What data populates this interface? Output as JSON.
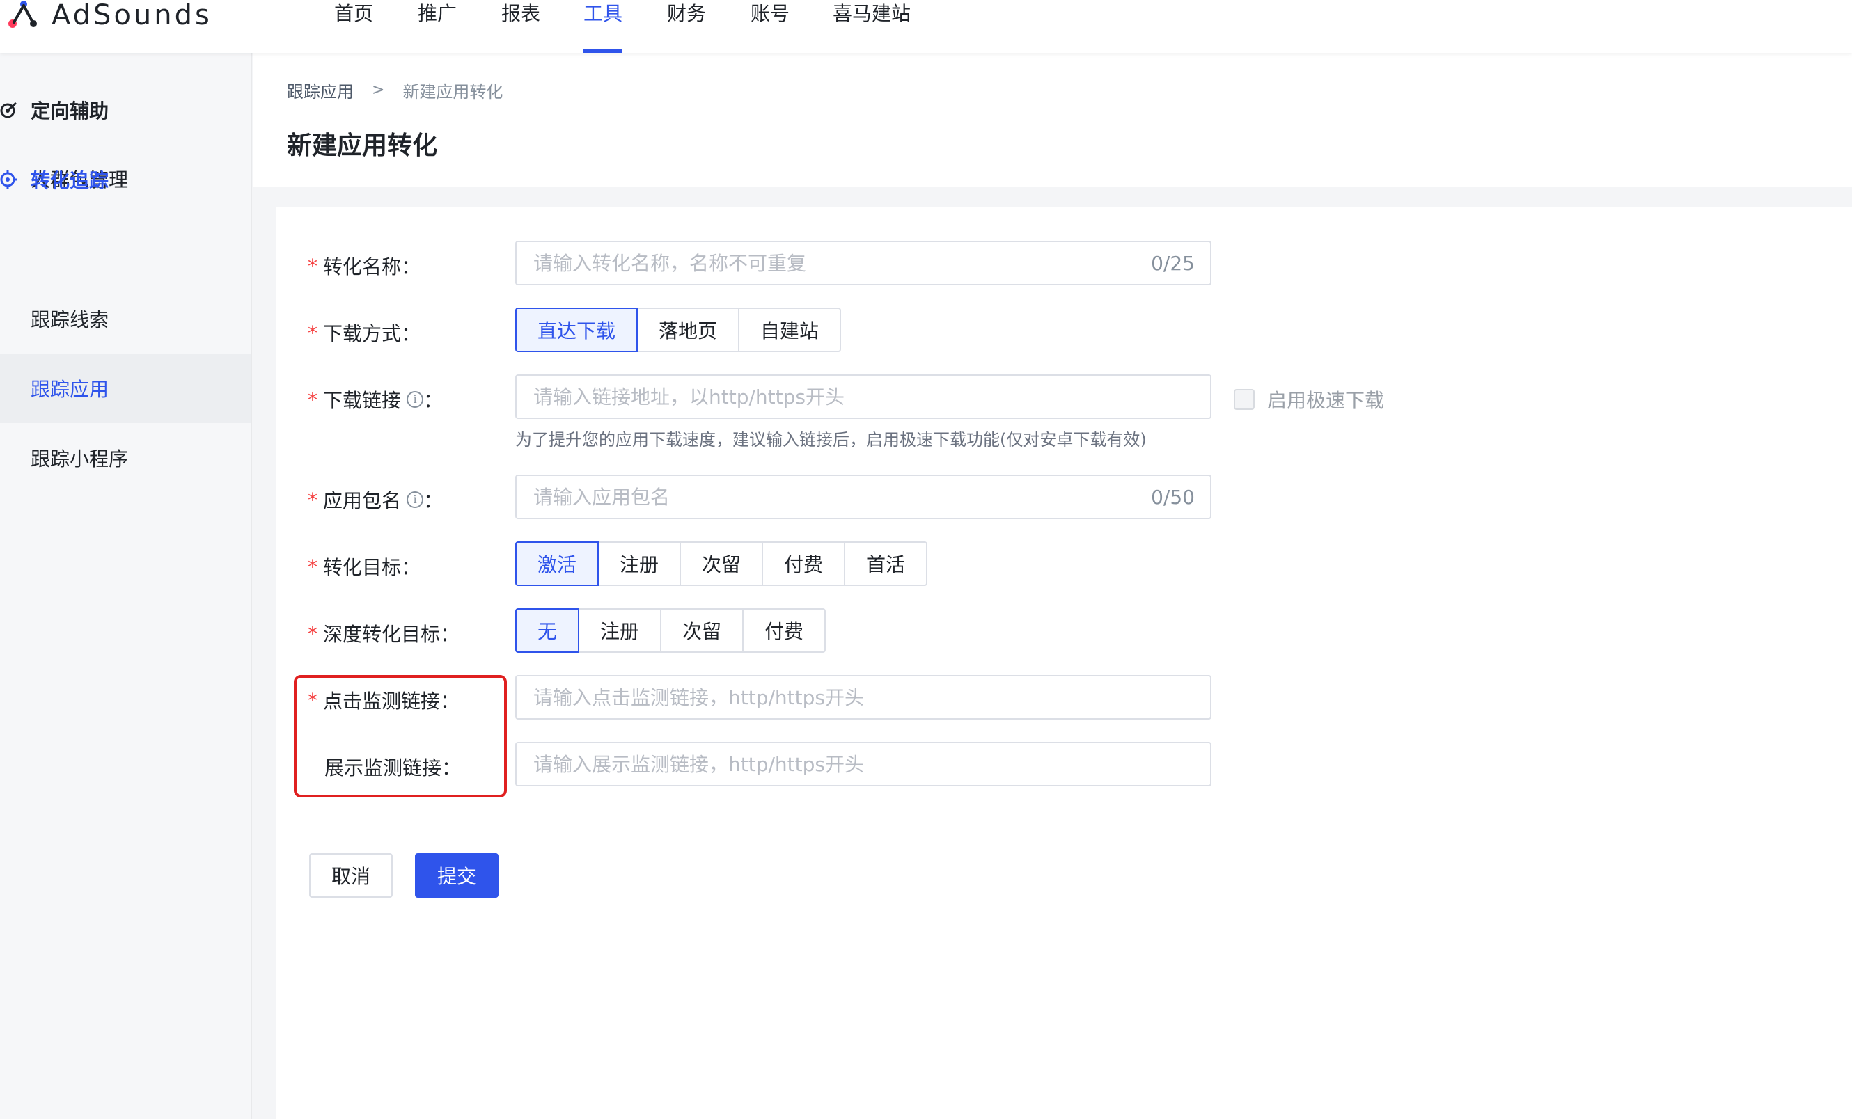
{
  "brand": {
    "name": "AdSounds"
  },
  "nav": {
    "items": [
      "首页",
      "推广",
      "报表",
      "工具",
      "财务",
      "账号",
      "喜马建站"
    ],
    "active_index": 3
  },
  "sidebar": {
    "group1": {
      "label": "定向辅助",
      "icon": "target-icon"
    },
    "item_crowd": "人群包管理",
    "group2": {
      "label": "转化追踪",
      "icon": "crosshair-icon"
    },
    "item_leads": "跟踪线索",
    "item_app": "跟踪应用",
    "item_miniprogram": "跟踪小程序",
    "active_item": "跟踪应用"
  },
  "breadcrumb": {
    "parent": "跟踪应用",
    "separator": ">",
    "current": "新建应用转化"
  },
  "page_title": "新建应用转化",
  "form": {
    "conversion_name": {
      "label": "转化名称",
      "placeholder": "请输入转化名称，名称不可重复",
      "count": "0/25",
      "required": true
    },
    "download_method": {
      "label": "下载方式",
      "options": [
        "直达下载",
        "落地页",
        "自建站"
      ],
      "selected": "直达下载",
      "required": true
    },
    "download_link": {
      "label": "下载链接",
      "placeholder": "请输入链接地址，以http/https开头",
      "hint": "为了提升您的应用下载速度，建议输入链接后，启用极速下载功能(仅对安卓下载有效)",
      "checkbox_label": "启用极速下载",
      "checkbox_checked": false,
      "required": true
    },
    "package_name": {
      "label": "应用包名",
      "placeholder": "请输入应用包名",
      "count": "0/50",
      "required": true
    },
    "conversion_goal": {
      "label": "转化目标",
      "options": [
        "激活",
        "注册",
        "次留",
        "付费",
        "首活"
      ],
      "selected": "激活",
      "required": true
    },
    "deep_goal": {
      "label": "深度转化目标",
      "options": [
        "无",
        "注册",
        "次留",
        "付费"
      ],
      "selected": "无",
      "required": true
    },
    "click_monitor": {
      "label": "点击监测链接",
      "placeholder": "请输入点击监测链接，http/https开头",
      "required": true
    },
    "impression_monitor": {
      "label": "展示监测链接",
      "placeholder": "请输入展示监测链接，http/https开头",
      "required": false
    },
    "colon": "："
  },
  "actions": {
    "cancel": "取消",
    "submit": "提交"
  },
  "colors": {
    "primary": "#2f54eb",
    "required": "#f53f3f",
    "highlight": "#e02020"
  }
}
